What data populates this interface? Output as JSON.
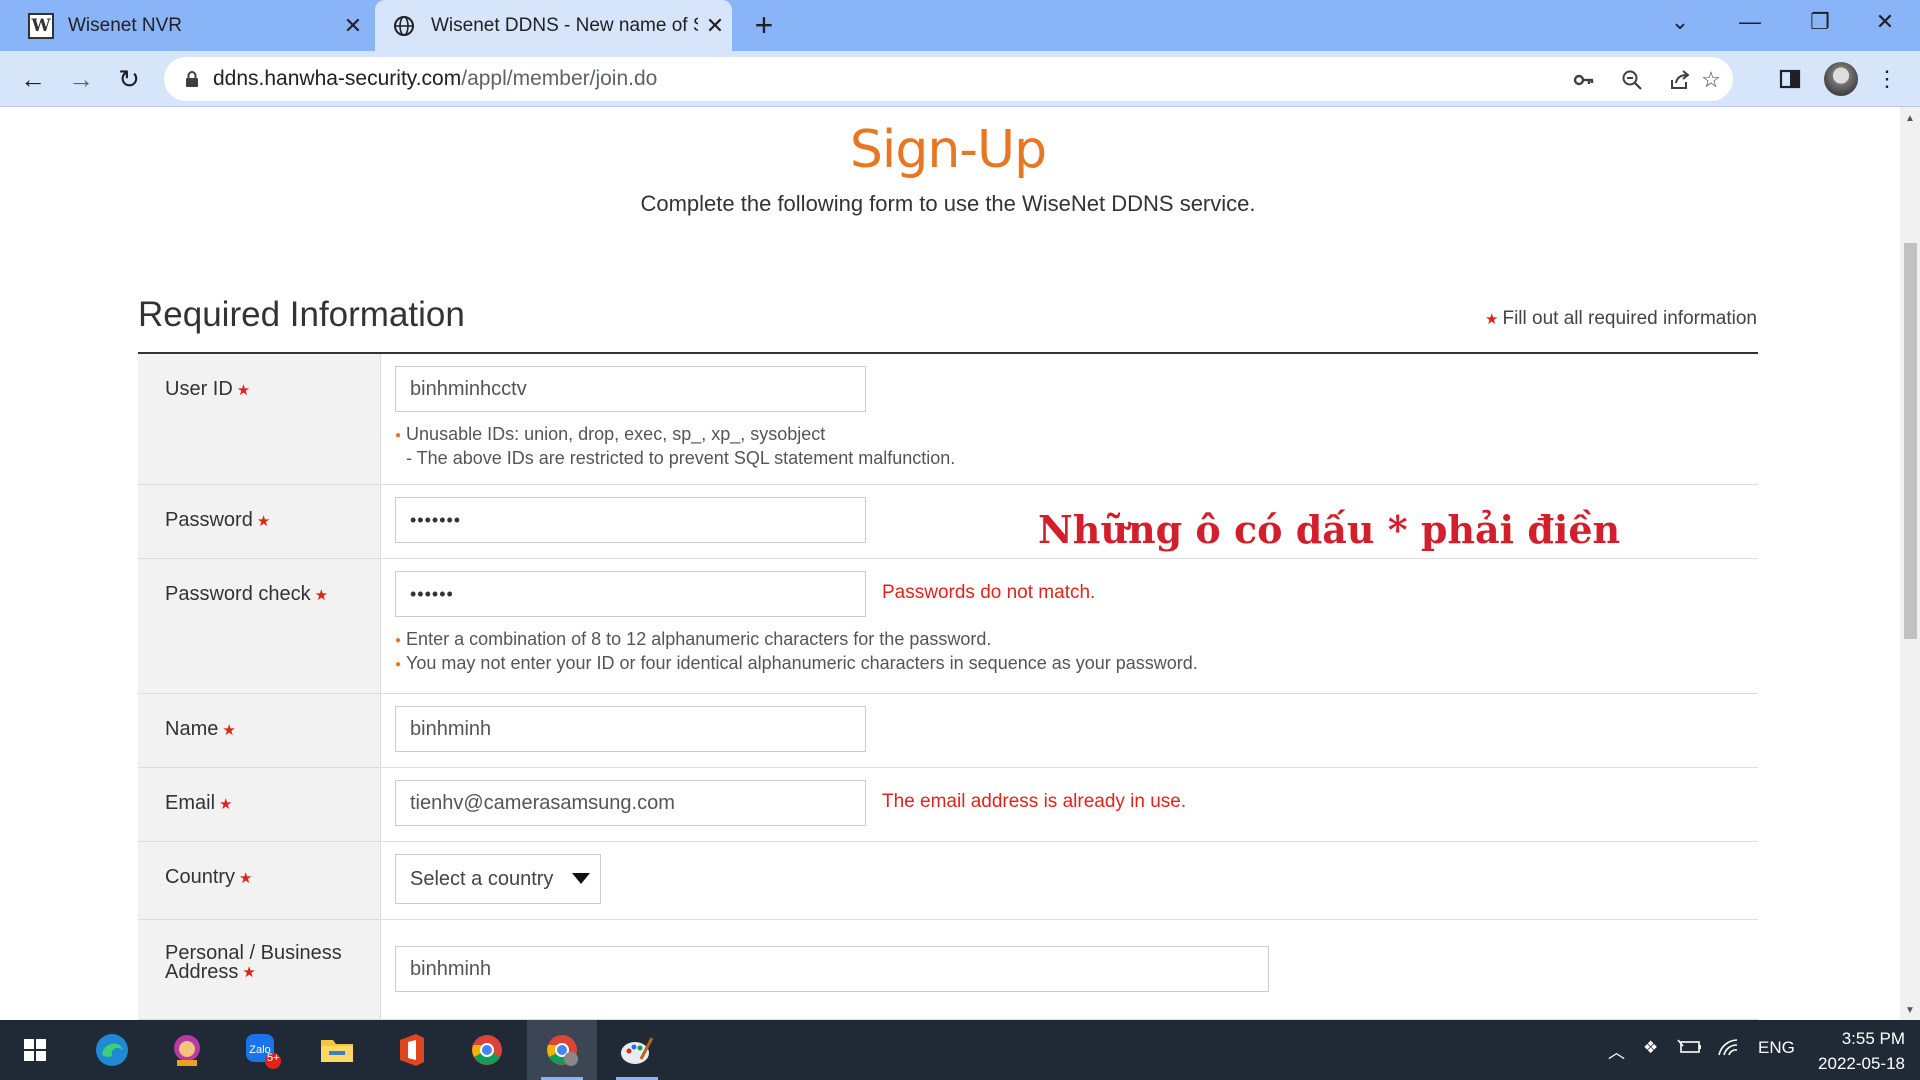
{
  "browser": {
    "tabs": [
      {
        "title": "Wisenet NVR",
        "favicon": "W"
      },
      {
        "title": "Wisenet DDNS - New name of Sa",
        "active": true
      }
    ],
    "url_domain": "ddns.hanwha-security.com",
    "url_path": "/appl/member/join.do"
  },
  "page": {
    "title": "Sign-Up",
    "subtitle": "Complete the following form to use the WiseNet DDNS service.",
    "section_title": "Required Information",
    "required_note": "Fill out all required information",
    "overlay_note": "Những ô có dấu * phải điền",
    "form": {
      "user_id": {
        "label": "User ID",
        "value": "binhminhcctv",
        "hint1": "Unusable IDs: union, drop, exec, sp_, xp_, sysobject",
        "hint2": "- The above IDs are restricted to prevent SQL statement malfunction."
      },
      "password": {
        "label": "Password",
        "value": "•••••••"
      },
      "password_check": {
        "label": "Password check",
        "value": "••••••",
        "error": "Passwords do not match.",
        "hint1": "Enter a combination of 8 to 12 alphanumeric characters for the password.",
        "hint2": "You may not enter your ID or four identical alphanumeric characters in sequence as your password."
      },
      "name": {
        "label": "Name",
        "value": "binhminh"
      },
      "email": {
        "label": "Email",
        "value": "tienhv@camerasamsung.com",
        "error": "The email address is already in use."
      },
      "country": {
        "label": "Country",
        "selected": "Select a country"
      },
      "address": {
        "label_line1": "Personal / Business",
        "label_line2": "Address",
        "value": "binhminh"
      }
    }
  },
  "taskbar": {
    "language": "ENG",
    "time": "3:55 PM",
    "date": "2022-05-18",
    "zalo_badge": "5+"
  },
  "colors": {
    "accent": "#e87722",
    "error": "#e2231a",
    "tabstrip": "#8ab4f8"
  }
}
